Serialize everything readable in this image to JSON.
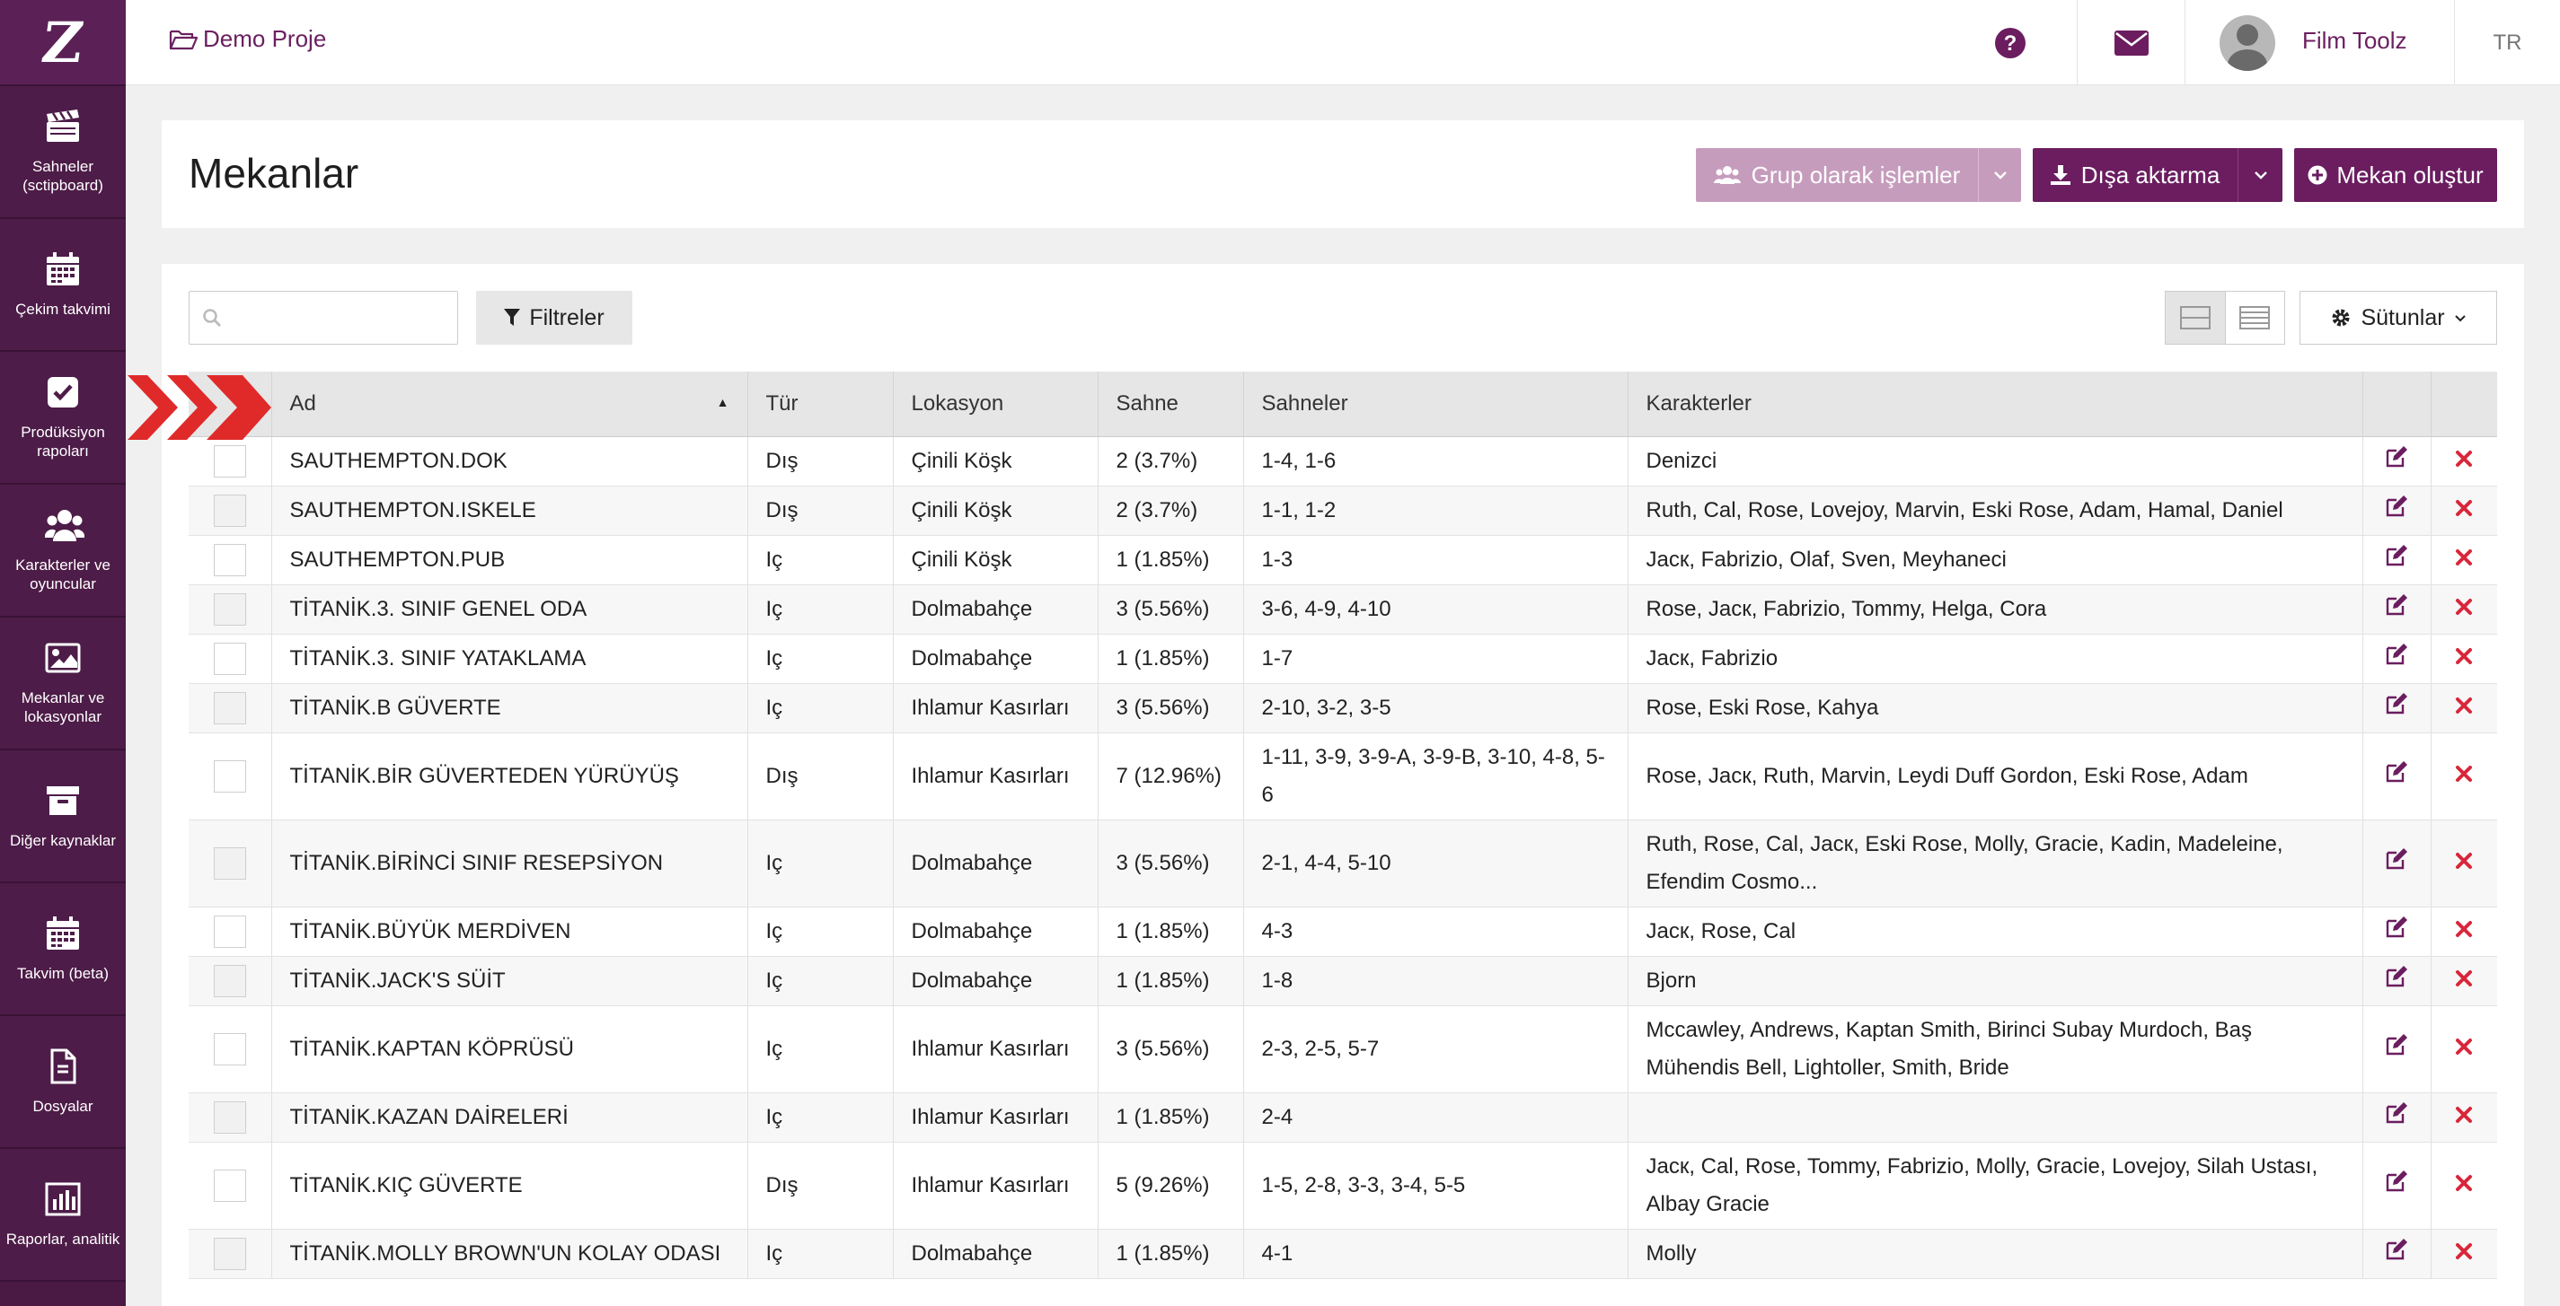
{
  "app": {
    "logo": "Z"
  },
  "sidebar": {
    "items": [
      {
        "label": "Sahneler (sctipboard)",
        "icon": "clapperboard-icon"
      },
      {
        "label": "Çekim takvimi",
        "icon": "calendar-icon"
      },
      {
        "label": "Prodüksiyon rapoları",
        "icon": "checkbox-icon"
      },
      {
        "label": "Karakterler ve oyuncular",
        "icon": "users-icon"
      },
      {
        "label": "Mekanlar ve lokasyonlar",
        "icon": "image-icon"
      },
      {
        "label": "Diğer kaynaklar",
        "icon": "archive-icon"
      },
      {
        "label": "Takvim (beta)",
        "icon": "calendar-icon"
      },
      {
        "label": "Dosyalar",
        "icon": "file-icon"
      },
      {
        "label": "Raporlar, analitik",
        "icon": "bar-chart-icon"
      }
    ]
  },
  "topbar": {
    "project": "Demo Proje",
    "user_name": "Film Toolz",
    "language": "TR"
  },
  "header": {
    "title": "Mekanlar",
    "group_ops_label": "Grup olarak işlemler",
    "export_label": "Dışa aktarma",
    "create_label": "Mekan oluştur"
  },
  "toolbar": {
    "search_placeholder": "",
    "filters_label": "Filtreler",
    "columns_label": "Sütunlar"
  },
  "table": {
    "columns": [
      "Ad",
      "Tür",
      "Lokasyon",
      "Sahne",
      "Sahneler",
      "Karakterler"
    ],
    "rows": [
      [
        "SAUTHEMPTON.DOK",
        "Dış",
        "Çinili Köşk",
        "2 (3.7%)",
        "1-4, 1-6",
        "Denizci"
      ],
      [
        "SAUTHEMPTON.ISKELE",
        "Dış",
        "Çinili Köşk",
        "2 (3.7%)",
        "1-1, 1-2",
        "Ruth, Cal, Rose, Lovejoy, Marvin, Eski Rose, Adam, Hamal, Daniel"
      ],
      [
        "SAUTHEMPTON.PUB",
        "Iç",
        "Çinili Köşk",
        "1 (1.85%)",
        "1-3",
        "Jacк, Fabrizio, Olaf, Sven, Meyhaneci"
      ],
      [
        "TİTANİK.3. SINIF GENEL ODA",
        "Iç",
        "Dolmabahçe",
        "3 (5.56%)",
        "3-6, 4-9, 4-10",
        "Rose, Jacк, Fabrizio, Tommy, Helga, Cora"
      ],
      [
        "TİTANİK.3. SINIF YATAKLAMA",
        "Iç",
        "Dolmabahçe",
        "1 (1.85%)",
        "1-7",
        "Jacк, Fabrizio"
      ],
      [
        "TİTANİK.B GÜVERTE",
        "Iç",
        "Ihlamur Kasırları",
        "3 (5.56%)",
        "2-10, 3-2, 3-5",
        "Rose, Eski Rose, Kahya"
      ],
      [
        "TİTANİK.BİR GÜVERTEDEN YÜRÜYÜŞ",
        "Dış",
        "Ihlamur Kasırları",
        "7 (12.96%)",
        "1-11, 3-9, 3-9-A, 3-9-B, 3-10, 4-8, 5-6",
        "Rose, Jacк, Ruth, Marvin, Leydi Duff Gordon, Eski Rose, Adam"
      ],
      [
        "TİTANİK.BİRİNCİ SINIF RESEPSİYON",
        "Iç",
        "Dolmabahçe",
        "3 (5.56%)",
        "2-1, 4-4, 5-10",
        "Ruth, Rose, Cal, Jacк, Eski Rose, Molly, Gracie, Kadin, Madeleine, Efendim Cosmo..."
      ],
      [
        "TİTANİK.BÜYÜK MERDİVEN",
        "Iç",
        "Dolmabahçe",
        "1 (1.85%)",
        "4-3",
        "Jacк, Rose, Cal"
      ],
      [
        "TİTANİK.JACK'S SÜİT",
        "Iç",
        "Dolmabahçe",
        "1 (1.85%)",
        "1-8",
        "Bjorn"
      ],
      [
        "TİTANİK.KAPTAN KÖPRÜSÜ",
        "Iç",
        "Ihlamur Kasırları",
        "3 (5.56%)",
        "2-3, 2-5, 5-7",
        "Mccawley, Andrews, Kaptan Smith, Birinci Subay Murdoch, Baş Mühendis Bell, Lightoller, Smith, Bride"
      ],
      [
        "TİTANİK.KAZAN DAİRELERİ",
        "Iç",
        "Ihlamur Kasırları",
        "1 (1.85%)",
        "2-4",
        ""
      ],
      [
        "TİTANİK.KIÇ GÜVERTE",
        "Dış",
        "Ihlamur Kasırları",
        "5 (9.26%)",
        "1-5, 2-8, 3-3, 3-4, 5-5",
        "Jacк, Cal, Rose, Tommy, Fabrizio, Molly, Gracie, Lovejoy, Silah Ustası, Albay Gracie"
      ],
      [
        "TİTANİK.MOLLY BROWN'UN KOLAY ODASI",
        "Iç",
        "Dolmabahçe",
        "1 (1.85%)",
        "4-1",
        "Molly"
      ]
    ]
  },
  "colors": {
    "sidebar": "#4a1a45",
    "accent": "#6b1d60",
    "accent_light": "#c69cbd",
    "delete": "#d9263a",
    "tutorial_arrow": "#e02a2a"
  }
}
